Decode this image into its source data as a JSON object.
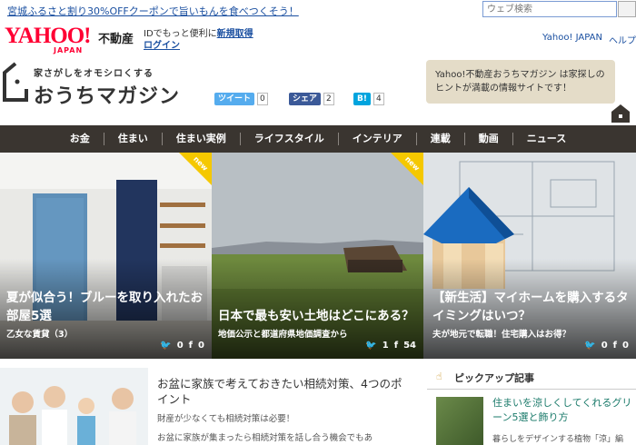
{
  "topbar": {
    "promo": "宮城ふるさと割り30%OFFクーポンで旨いもんを食べつくそう！",
    "search_placeholder": "ウェブ検索"
  },
  "header": {
    "logo": "YAHOO!",
    "logo_sub": "JAPAN",
    "service": "不動産",
    "id_text": "IDでもっと便利に",
    "signup": "新規取得",
    "login": "ログイン",
    "yahoo_japan_link": "Yahoo! JAPAN",
    "help_link": "ヘルプ"
  },
  "brand": {
    "tagline": "家さがしをオモシロくする",
    "name": "おうちマガジン"
  },
  "social": {
    "tweet_label": "ツイート",
    "tweet_count": "0",
    "share_label": "シェア",
    "share_count": "2",
    "hatena_label": "B!",
    "hatena_count": "4"
  },
  "bubble_text": "Yahoo!不動産おうちマガジン は家探しのヒントが満載の情報サイトです！",
  "nav": [
    "お金",
    "住まい",
    "住まい実例",
    "ライフスタイル",
    "インテリア",
    "連載",
    "動画",
    "ニュース"
  ],
  "featured": [
    {
      "title": "夏が似合う！ブルーを取り入れたお部屋5選",
      "sub": "乙女な賃貸（3）",
      "tweets": "0",
      "likes": "0",
      "badge": "new"
    },
    {
      "title": "日本で最も安い土地はどこにある？",
      "sub": "地価公示と都道府県地価調査から",
      "tweets": "1",
      "likes": "54",
      "badge": "new"
    },
    {
      "title": "【新生活】マイホームを購入するタイミングはいつ？",
      "sub": "夫が地元で転職！住宅購入はお得？",
      "tweets": "0",
      "likes": "0",
      "badge": ""
    }
  ],
  "article": {
    "title": "お盆に家族で考えておきたい相続対策、4つのポイント",
    "desc1": "財産が少なくても相続対策は必要！",
    "desc2": "お盆に家族が集まったら相続対策を話し合う機会でもあ"
  },
  "pickup": {
    "heading": "ピックアップ記事",
    "title": "住まいを涼しくしてくれるグリーン5選と飾り方",
    "sub": "暮らしをデザインする植物「涼」編"
  },
  "colors": {
    "nav_bg": "#3a3530",
    "yahoo_red": "#ff0033",
    "link": "#1a4fa0",
    "bubble": "#e4dcc8",
    "badge": "#f5c800"
  }
}
